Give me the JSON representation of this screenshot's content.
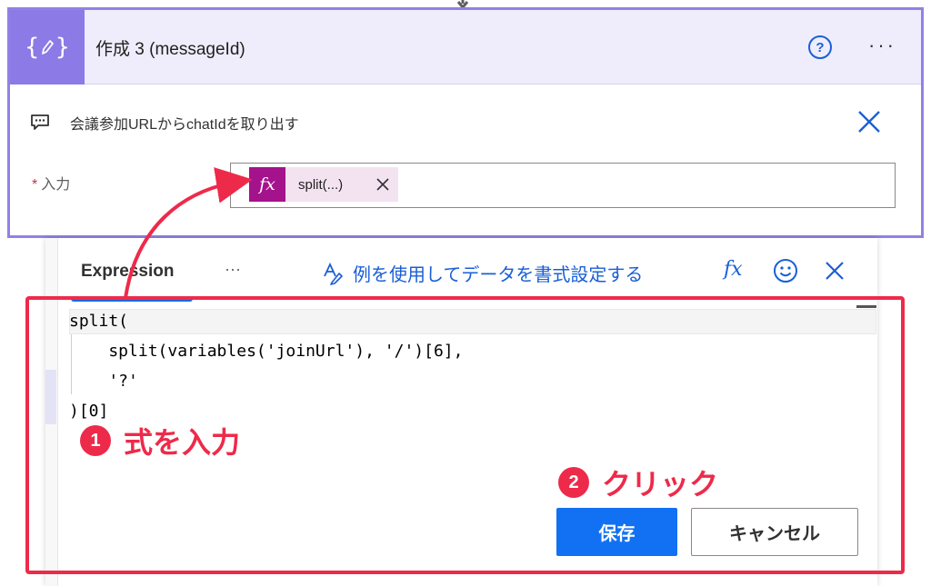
{
  "card": {
    "title": "作成 3 (messageId)",
    "comment": "会議参加URLからchatIdを取り出す",
    "input_label": "入力",
    "required_mark": "*",
    "token_label": "split(...)",
    "token_icon": "fx"
  },
  "panel": {
    "tab_expression": "Expression",
    "tab_more": "···",
    "format_link": "例を使用してデータを書式設定する",
    "fx_label": "fx",
    "code_lines": [
      "split(",
      "    split(variables('joinUrl'), '/')[6],",
      "    '?'",
      ")[0]"
    ],
    "save_label": "保存",
    "cancel_label": "キャンセル"
  },
  "annotations": {
    "step1_number": "1",
    "step1_text": "式を入力",
    "step2_number": "2",
    "step2_text": "クリック"
  },
  "icons": {
    "header": "compose-icon",
    "help": "help-icon",
    "more": "more-icon",
    "comment": "comment-icon",
    "close": "close-icon",
    "format": "format-data-icon",
    "emoji": "emoji-icon"
  },
  "colors": {
    "card_border": "#8f82e6",
    "header_bg": "#efedfb",
    "icon_bg": "#8c7ae6",
    "token_fx_bg": "#a4128c",
    "accent_blue": "#1271f2",
    "annotation_red": "#ee2a4a"
  }
}
